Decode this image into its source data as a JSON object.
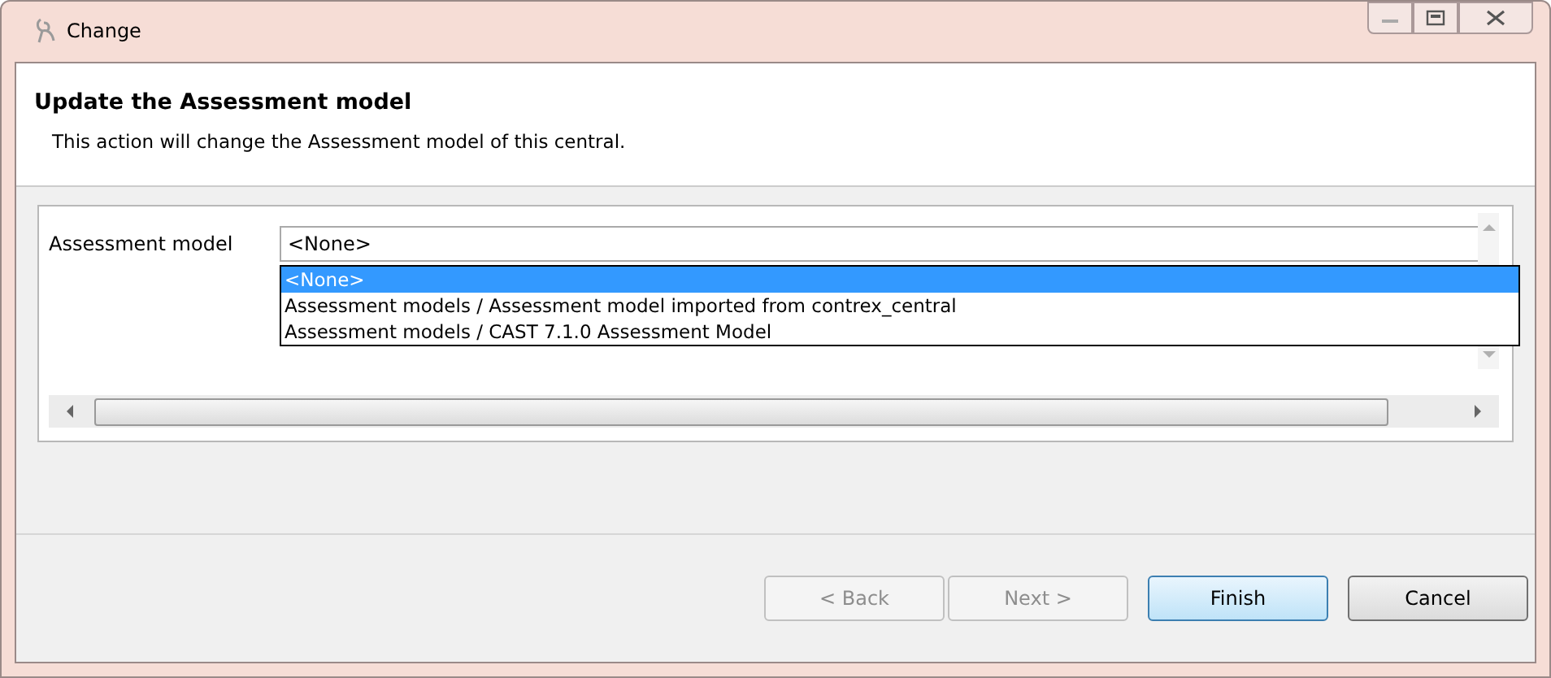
{
  "window": {
    "title": "Change"
  },
  "header": {
    "title": "Update the Assessment model",
    "description": "This action will change the Assessment model of this central."
  },
  "form": {
    "label": "Assessment model",
    "value": "<None>",
    "dropdown_open": true,
    "options": [
      {
        "label": "<None>",
        "selected": true
      },
      {
        "label": "Assessment models / Assessment model imported from contrex_central",
        "selected": false
      },
      {
        "label": "Assessment models / CAST 7.1.0 Assessment Model",
        "selected": false
      }
    ]
  },
  "buttons": [
    {
      "label": "< Back",
      "disabled": true,
      "default": false
    },
    {
      "label": "Next >",
      "disabled": true,
      "default": false
    },
    {
      "label": "Finish",
      "disabled": false,
      "default": true
    },
    {
      "label": "Cancel",
      "disabled": false,
      "default": false
    }
  ]
}
